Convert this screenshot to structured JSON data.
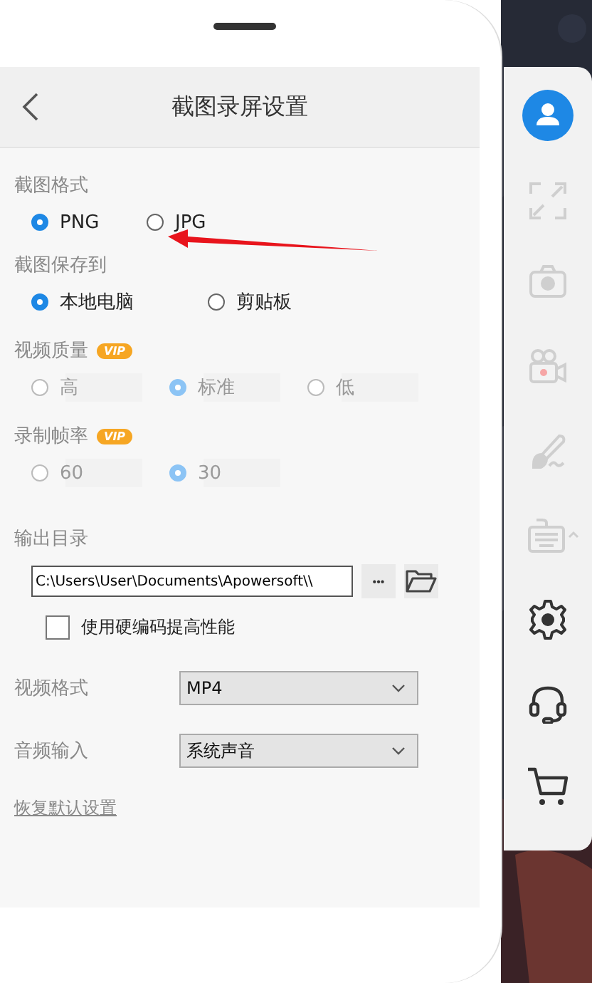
{
  "header": {
    "title": "截图录屏设置"
  },
  "sections": [
    {
      "label": "截图格式",
      "disabled": false,
      "options": [
        {
          "label": "PNG",
          "selected": true
        },
        {
          "label": "JPG",
          "selected": false
        }
      ]
    },
    {
      "label": "截图保存到",
      "disabled": false,
      "options": [
        {
          "label": "本地电脑",
          "selected": true
        },
        {
          "label": "剪贴板",
          "selected": false
        }
      ]
    },
    {
      "label": "视频质量",
      "badge": "VIP",
      "disabled": true,
      "options": [
        {
          "label": "高",
          "selected": false
        },
        {
          "label": "标准",
          "selected": true
        },
        {
          "label": "低",
          "selected": false
        }
      ]
    },
    {
      "label": "录制帧率",
      "badge": "VIP",
      "disabled": true,
      "options": [
        {
          "label": "60",
          "selected": false
        },
        {
          "label": "30",
          "selected": true
        }
      ]
    }
  ],
  "output": {
    "label": "输出目录",
    "path": "C:\\Users\\User\\Documents\\Apowersoft\\\\",
    "more_button": "•••",
    "checkbox": {
      "label": "使用硬编码提高性能",
      "checked": false
    }
  },
  "selects": [
    {
      "label": "视频格式",
      "value": "MP4"
    },
    {
      "label": "音频输入",
      "value": "系统声音"
    }
  ],
  "reset_link": "恢复默认设置",
  "toolbar": [
    {
      "kind": "avatar",
      "disabled": false
    },
    {
      "kind": "fullscreen",
      "disabled": true
    },
    {
      "kind": "camera",
      "disabled": true
    },
    {
      "kind": "video",
      "disabled": true
    },
    {
      "kind": "brush",
      "disabled": true
    },
    {
      "kind": "keyboard",
      "disabled": true
    },
    {
      "kind": "gear",
      "disabled": false
    },
    {
      "kind": "headset",
      "disabled": false
    },
    {
      "kind": "cart",
      "disabled": false
    }
  ]
}
